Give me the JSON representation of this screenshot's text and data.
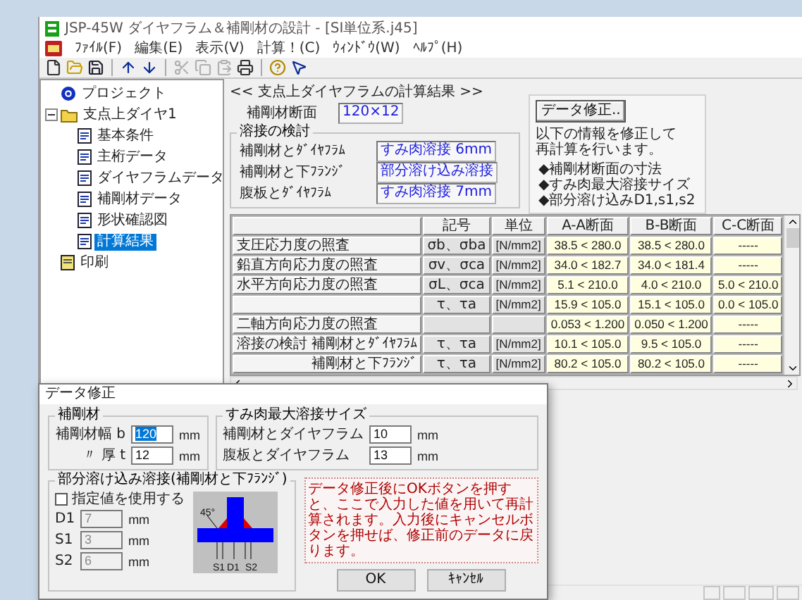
{
  "window": {
    "title": "JSP-45W ダイヤフラム＆補剛材の設計 - [SI単位系.j45]"
  },
  "menu": [
    "ﾌｧｲﾙ(F)",
    "編集(E)",
    "表示(V)",
    "計算！(C)",
    "ｳｨﾝﾄﾞｳ(W)",
    "ﾍﾙﾌﾟ(H)"
  ],
  "toolbar": [
    {
      "kind": "new",
      "disabled": false
    },
    {
      "kind": "open",
      "disabled": false
    },
    {
      "kind": "save",
      "disabled": false
    },
    {
      "kind": "separator"
    },
    {
      "kind": "up",
      "disabled": false
    },
    {
      "kind": "down",
      "disabled": false
    },
    {
      "kind": "separator"
    },
    {
      "kind": "cut",
      "disabled": true
    },
    {
      "kind": "copy",
      "disabled": true
    },
    {
      "kind": "paste",
      "disabled": true
    },
    {
      "kind": "print",
      "disabled": false
    },
    {
      "kind": "separator"
    },
    {
      "kind": "help",
      "disabled": false
    },
    {
      "kind": "whatsthis",
      "disabled": false
    }
  ],
  "tree": [
    {
      "label": "プロジェクト",
      "kind": "project",
      "selected": false
    },
    {
      "label": "支点上ダイヤ1",
      "kind": "folder",
      "selected": false,
      "expanded": true,
      "children": [
        {
          "label": "基本条件",
          "kind": "page",
          "selected": false
        },
        {
          "label": "主桁データ",
          "kind": "page",
          "selected": false
        },
        {
          "label": "ダイヤフラムデータ",
          "kind": "page",
          "selected": false
        },
        {
          "label": "補剛材データ",
          "kind": "page",
          "selected": false
        },
        {
          "label": "形状確認図",
          "kind": "page",
          "selected": false
        },
        {
          "label": "計算結果",
          "kind": "page",
          "selected": true
        }
      ]
    },
    {
      "label": "印刷",
      "kind": "print",
      "selected": false
    }
  ],
  "result": {
    "heading": "<< 支点上ダイヤフラムの計算結果 >>",
    "section": {
      "label": "補剛材断面",
      "value": "120×12"
    },
    "weld_group": {
      "title": "溶接の検討",
      "rows": [
        {
          "label": "補剛材とﾀﾞｲﾔﾌﾗﾑ",
          "value": "すみ肉溶接 6mm"
        },
        {
          "label": "補剛材と下ﾌﾗﾝｼﾞ",
          "value": "部分溶け込み溶接"
        },
        {
          "label": "腹板とﾀﾞｲﾔﾌﾗﾑ",
          "value": "すみ肉溶接 7mm"
        }
      ]
    },
    "edit_panel": {
      "button": "データ修正..",
      "note": [
        "以下の情報を修正して",
        "再計算を行います。"
      ],
      "bullets": [
        "◆補剛材断面の寸法",
        "◆すみ肉最大溶接サイズ",
        "◆部分溶け込みD1,s1,s2"
      ]
    }
  },
  "table": {
    "columns": [
      "記号",
      "単位",
      "A-A断面",
      "B-B断面",
      "C-C断面"
    ],
    "rows": [
      {
        "kind": "main",
        "label": "支圧応力度の照査",
        "symbol": "σb、σba",
        "unit": "[N/mm2]",
        "values": [
          "38.5 < 280.0",
          "38.5 < 280.0",
          "-----"
        ]
      },
      {
        "kind": "main",
        "label": "鉛直方向応力度の照査",
        "symbol": "σv、σca",
        "unit": "[N/mm2]",
        "values": [
          "34.0 < 182.7",
          "34.0 < 181.4",
          "-----"
        ]
      },
      {
        "kind": "main",
        "label": "水平方向応力度の照査",
        "symbol": "σL、σca",
        "unit": "[N/mm2]",
        "values": [
          "5.1 < 210.0",
          "4.0 < 210.0",
          "5.0 < 210.0"
        ]
      },
      {
        "kind": "main",
        "symbol": "τ、τa",
        "unit": "[N/mm2]",
        "values": [
          "15.9 < 105.0",
          "15.1 < 105.0",
          "0.0 < 105.0"
        ]
      },
      {
        "kind": "main",
        "label": "二軸方向応力度の照査",
        "values": [
          "0.053 < 1.200",
          "0.050 < 1.200",
          "-----"
        ]
      },
      {
        "kind": "main",
        "label": "溶接の検討 補剛材とﾀﾞｲﾔﾌﾗﾑ",
        "symbol": "τ、τa",
        "unit": "[N/mm2]",
        "values": [
          "10.1 < 105.0",
          "9.5 < 105.0",
          "-----"
        ]
      },
      {
        "kind": "sub",
        "label": "補剛材と下ﾌﾗﾝｼﾞ",
        "symbol": "τ、τa",
        "unit": "[N/mm2]",
        "values": [
          "80.2 < 105.0",
          "80.2 < 105.0",
          "-----"
        ]
      }
    ]
  },
  "dialog": {
    "title": "データ修正",
    "stiffener": {
      "title": "補剛材",
      "fields": [
        {
          "label": "補剛材幅 b",
          "value": "120",
          "unit": "mm",
          "selected": true
        },
        {
          "label": "〃 厚 t",
          "value": "12",
          "unit": "mm",
          "selected": false
        }
      ]
    },
    "fillet": {
      "title": "すみ肉最大溶接サイズ",
      "fields": [
        {
          "label": "補剛材とダイヤフラム",
          "value": "10",
          "unit": "mm"
        },
        {
          "label": "腹板とダイヤフラム",
          "value": "13",
          "unit": "mm"
        }
      ]
    },
    "partial": {
      "title": "部分溶け込み溶接(補剛材と下ﾌﾗﾝｼﾞ)",
      "checkbox": {
        "label": "指定値を使用する",
        "checked": false
      },
      "fields": [
        {
          "label": "D1",
          "value": "7",
          "unit": "mm",
          "disabled": true
        },
        {
          "label": "S1",
          "value": "3",
          "unit": "mm",
          "disabled": true
        },
        {
          "label": "S2",
          "value": "6",
          "unit": "mm",
          "disabled": true
        }
      ],
      "diagram_labels": [
        "45°",
        "S1",
        "D1",
        "S2"
      ]
    },
    "message": "データ修正後にOKボタンを押すと、ここで入力した値を用いて再計算されます。入力後にキャンセルボタンを押せば、修正前のデータに戻ります。",
    "buttons": [
      "OK",
      "ｷｬﾝｾﾙ"
    ]
  }
}
